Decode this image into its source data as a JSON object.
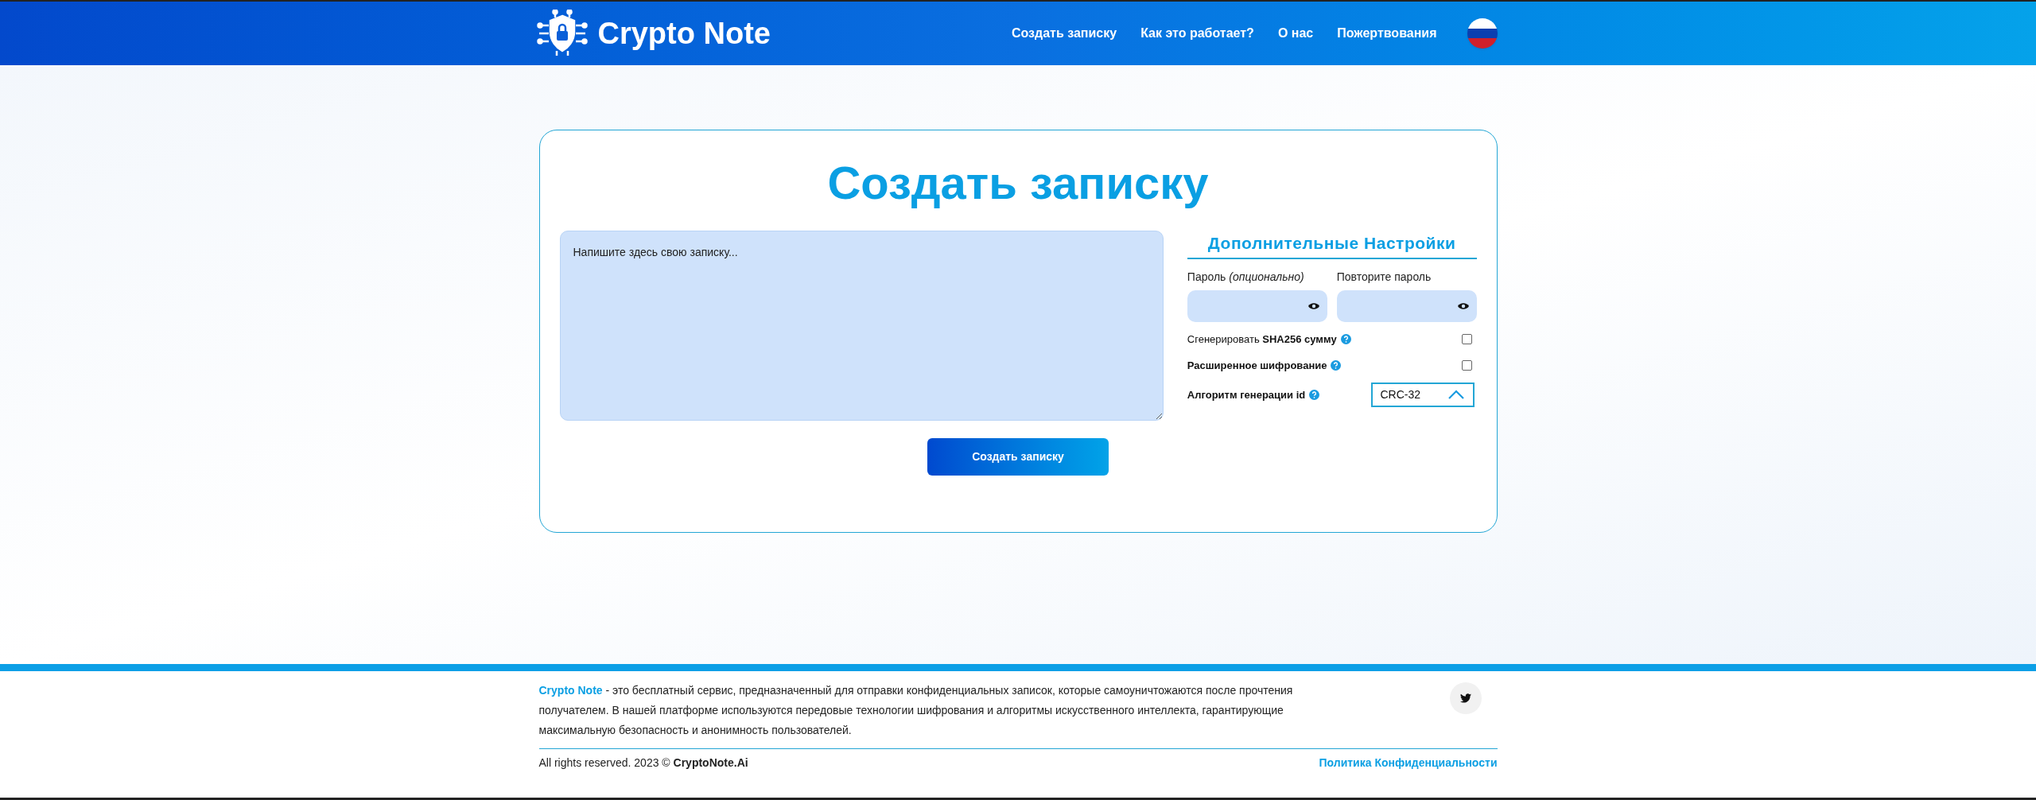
{
  "header": {
    "logo_text": "Crypto Note",
    "nav": [
      {
        "label": "Создать записку"
      },
      {
        "label": "Как это работает?"
      },
      {
        "label": "О нас"
      },
      {
        "label": "Пожертвования"
      }
    ]
  },
  "card": {
    "title": "Создать записку",
    "note": {
      "placeholder": "Напишите здесь свою записку..."
    },
    "submit": "Создать записку",
    "settings": {
      "title": "Дополнительные Настройки",
      "password": {
        "label": "Пароль *(опционально)*"
      },
      "repeat_password": {
        "label": "Повторите пароль"
      },
      "options": [
        {
          "kind": "checkbox",
          "label": "Сгенерировать **SHA256 сумму**",
          "checked": false
        },
        {
          "kind": "checkbox",
          "label": "**Расширенное шифрование**",
          "checked": false
        },
        {
          "kind": "select",
          "label": "**Алгоритм генерации id**",
          "value": "CRC-32",
          "expanded": true
        }
      ]
    }
  },
  "footer": {
    "brand_link": "Crypto Note",
    "description": " - это бесплатный сервис, предназначенный для отправки конфиденциальных записок, которые самоуничтожаются после прочтения получателем. В нашей платформе используются передовые технологии шифрования и алгоритмы искусственного интеллекта, гарантирующие максимальную безопасность и анонимность пользователей.",
    "copyright": "All rights reserved. 2023 © **CryptoNote.Ai**",
    "privacy_link": "Политика Конфиденциальности"
  }
}
